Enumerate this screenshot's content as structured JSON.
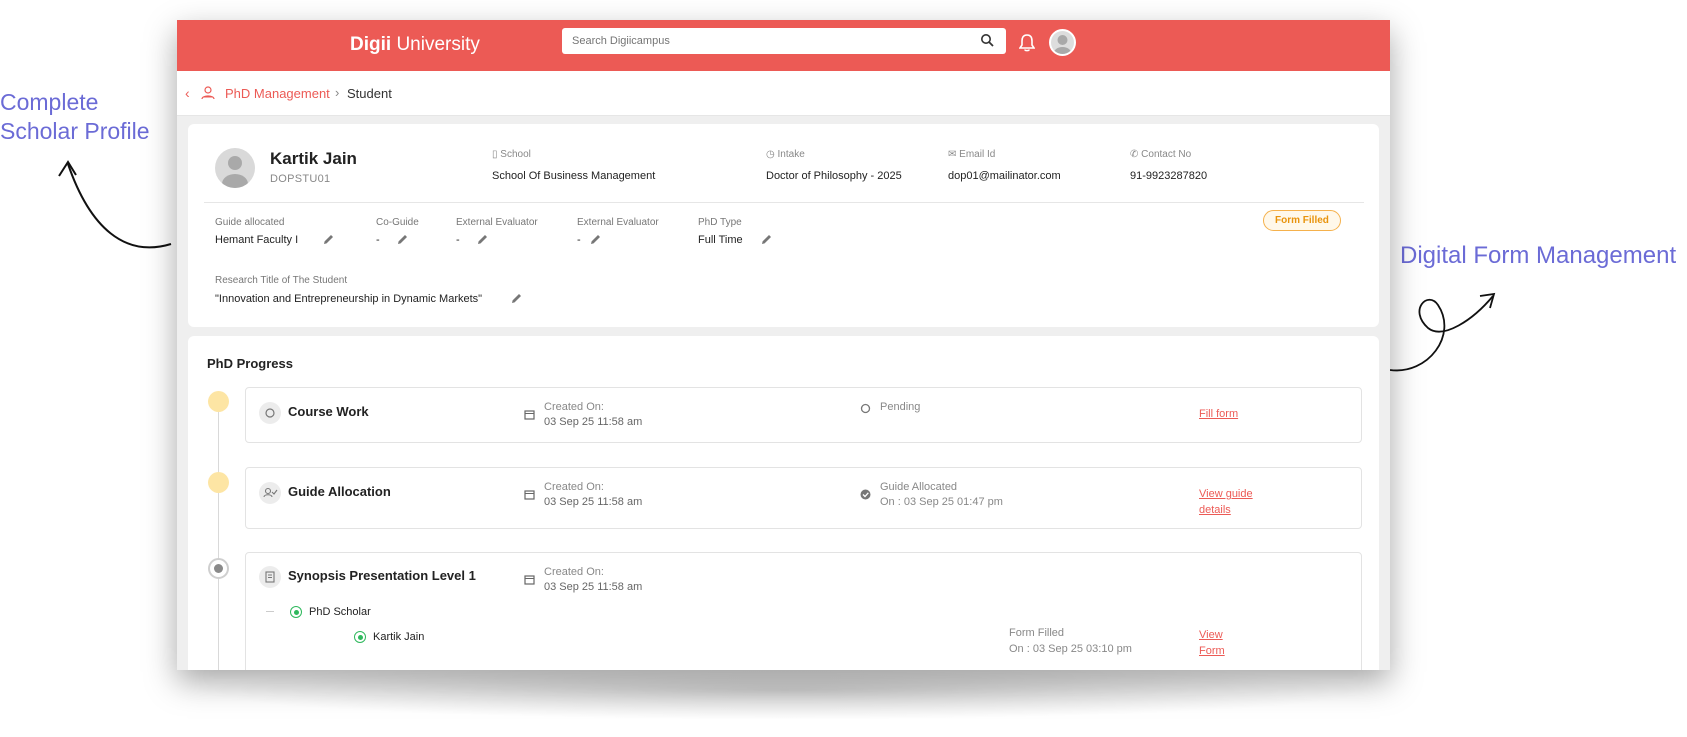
{
  "annotations": {
    "left_line1": "Complete",
    "left_line2": "Scholar Profile",
    "right": "Digital Form Management"
  },
  "header": {
    "brand_prefix": "Digii",
    "brand_suffix": " University",
    "search_placeholder": "Search Digiicampus"
  },
  "breadcrumb": {
    "parent": "PhD Management",
    "current": "Student"
  },
  "profile": {
    "name": "Kartik Jain",
    "id": "DOPSTU01",
    "school_label": "School",
    "school": "School Of Business Management",
    "intake_label": "Intake",
    "intake": "Doctor of Philosophy - 2025",
    "email_label": "Email Id",
    "email": "dop01@mailinator.com",
    "contact_label": "Contact No",
    "contact": "91-9923287820",
    "status_badge": "Form Filled",
    "fields": {
      "guide_label": "Guide allocated",
      "guide": "Hemant Faculty I",
      "coguide_label": "Co-Guide",
      "coguide": "-",
      "ext1_label": "External Evaluator",
      "ext1": "-",
      "ext2_label": "External Evaluator",
      "ext2": "-",
      "phd_type_label": "PhD Type",
      "phd_type": "Full Time",
      "research_label": "Research Title of The Student",
      "research": "\"Innovation and Entrepreneurship in Dynamic Markets\""
    }
  },
  "progress": {
    "title": "PhD Progress",
    "steps": [
      {
        "title": "Course Work",
        "created_label": "Created On:",
        "created": "03 Sep 25 11:58 am",
        "status": "Pending",
        "status_sub": "",
        "action": "Fill form"
      },
      {
        "title": "Guide Allocation",
        "created_label": "Created On:",
        "created": "03 Sep 25 11:58 am",
        "status": "Guide Allocated",
        "status_sub": "On : 03 Sep 25 01:47 pm",
        "action_line1": "View guide",
        "action_line2": "details"
      },
      {
        "title": "Synopsis Presentation Level 1",
        "created_label": "Created On:",
        "created": "03 Sep 25 11:58 am",
        "sub_group": "PhD Scholar",
        "sub_person": "Kartik Jain",
        "sub_status": "Form Filled",
        "sub_status_on": "On : 03 Sep 25 03:10 pm",
        "action_line1": "View",
        "action_line2": "Form"
      }
    ]
  },
  "colors": {
    "brand": "#ec5a55",
    "annotation": "#6b6bd6",
    "badge": "#e8930c"
  }
}
